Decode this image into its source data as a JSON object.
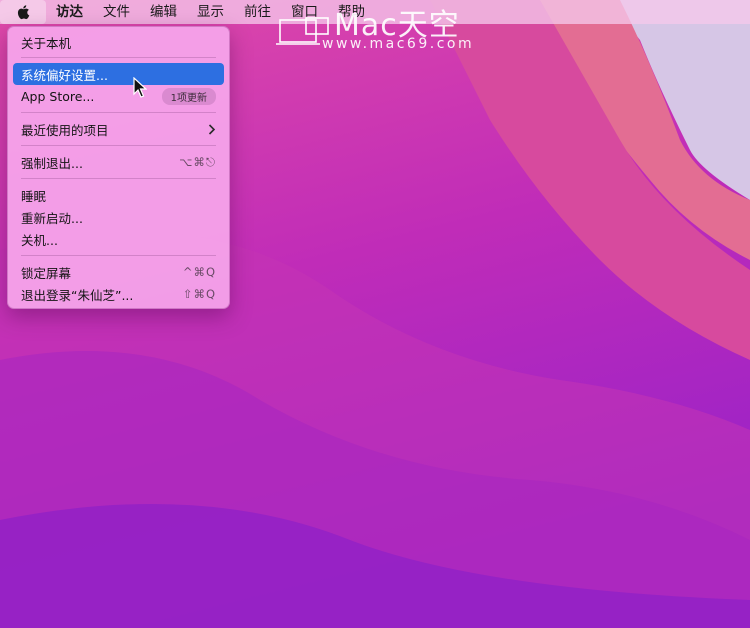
{
  "menubar": {
    "items": [
      "访达",
      "文件",
      "编辑",
      "显示",
      "前往",
      "窗口",
      "帮助"
    ]
  },
  "watermark": {
    "brand": "Mac天空",
    "url": "www.mac69.com"
  },
  "apple_menu": {
    "about": "关于本机",
    "system_prefs": "系统偏好设置...",
    "app_store": "App Store...",
    "app_store_badge": "1项更新",
    "recent_items": "最近使用的项目",
    "force_quit": "强制退出...",
    "force_quit_shortcut": "⌥⌘⎋",
    "sleep": "睡眠",
    "restart": "重新启动...",
    "shutdown": "关机...",
    "lock_screen": "锁定屏幕",
    "lock_screen_shortcut": "^⌘Q",
    "logout": "退出登录“朱仙芝”...",
    "logout_shortcut": "⇧⌘Q"
  },
  "colors": {
    "highlight": "#2d6fe1",
    "wallpaper_top": "#d63ea8",
    "wallpaper_bottom": "#8a1fc4"
  }
}
